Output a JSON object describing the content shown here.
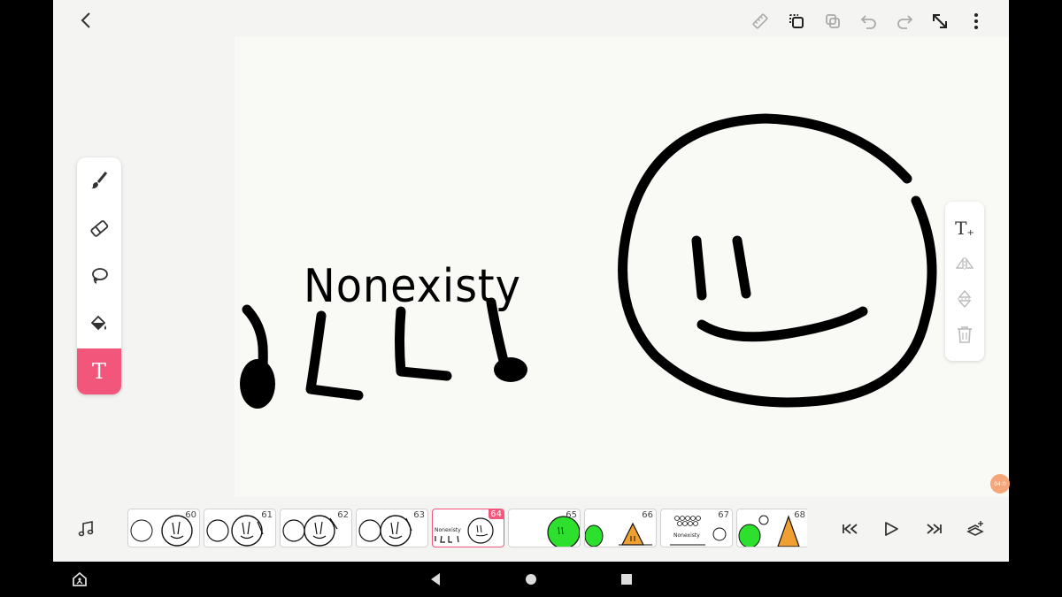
{
  "app": {
    "accent_color": "#f2567a",
    "topbar": {
      "back_icon": "chevron-left-icon",
      "icons": [
        "ruler-icon",
        "copy-layer-icon",
        "layers-icon",
        "undo-icon",
        "redo-icon",
        "fullscreen-icon",
        "more-vertical-icon"
      ]
    },
    "canvas": {
      "text": "Nonexisty",
      "drawing": "smiley face"
    },
    "tools": [
      {
        "name": "brush",
        "icon": "brush-icon"
      },
      {
        "name": "eraser",
        "icon": "eraser-icon"
      },
      {
        "name": "lasso",
        "icon": "lasso-icon"
      },
      {
        "name": "fill",
        "icon": "paint-bucket-icon"
      },
      {
        "name": "text",
        "icon": "text-tool-icon",
        "label": "T",
        "active": true
      }
    ],
    "text_panel": {
      "icons": [
        "add-text-icon",
        "flip-horizontal-icon",
        "flip-vertical-icon",
        "trash-icon"
      ],
      "add_text_label": "T"
    },
    "timeline": {
      "music_icon": "music-note-icon",
      "frames": [
        {
          "number": "60"
        },
        {
          "number": "61"
        },
        {
          "number": "62"
        },
        {
          "number": "63"
        },
        {
          "number": "64",
          "active": true,
          "text": "Nonexisty"
        },
        {
          "number": "65"
        },
        {
          "number": "66"
        },
        {
          "number": "67",
          "text": "Nonexisty"
        },
        {
          "number": "68"
        }
      ],
      "controls": [
        "skip-to-start-icon",
        "play-icon",
        "skip-to-end-icon",
        "onion-skin-icon"
      ]
    },
    "edge_button_label": "04:0"
  },
  "system_nav": {
    "icons": [
      "accessibility-icon",
      "back-triangle-icon",
      "home-circle-icon",
      "recents-square-icon"
    ]
  }
}
